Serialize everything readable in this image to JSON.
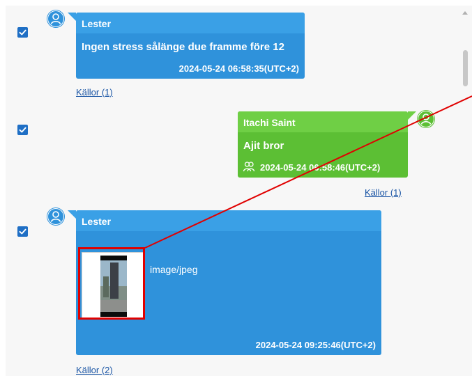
{
  "messages": [
    {
      "sender": "Lester",
      "text": "Ingen stress sålänge due framme före 12",
      "timestamp": "2024-05-24 06:58:35(UTC+2)",
      "sources": "Källor (1)",
      "checked": true,
      "side": "left",
      "color": "#2f92db"
    },
    {
      "sender": "Itachi Saint",
      "text": "Ajit bror",
      "timestamp": "2024-05-24 06:58:46(UTC+2)",
      "sources": "Källor (1)",
      "checked": true,
      "side": "right",
      "color": "#5cbf34",
      "icon": "group-icon"
    },
    {
      "sender": "Lester",
      "attachment_type": "image/jpeg",
      "timestamp": "2024-05-24 09:25:46(UTC+2)",
      "sources": "Källor (2)",
      "checked": true,
      "side": "left",
      "color": "#2f92db"
    }
  ],
  "annotation_color": "#e00000"
}
